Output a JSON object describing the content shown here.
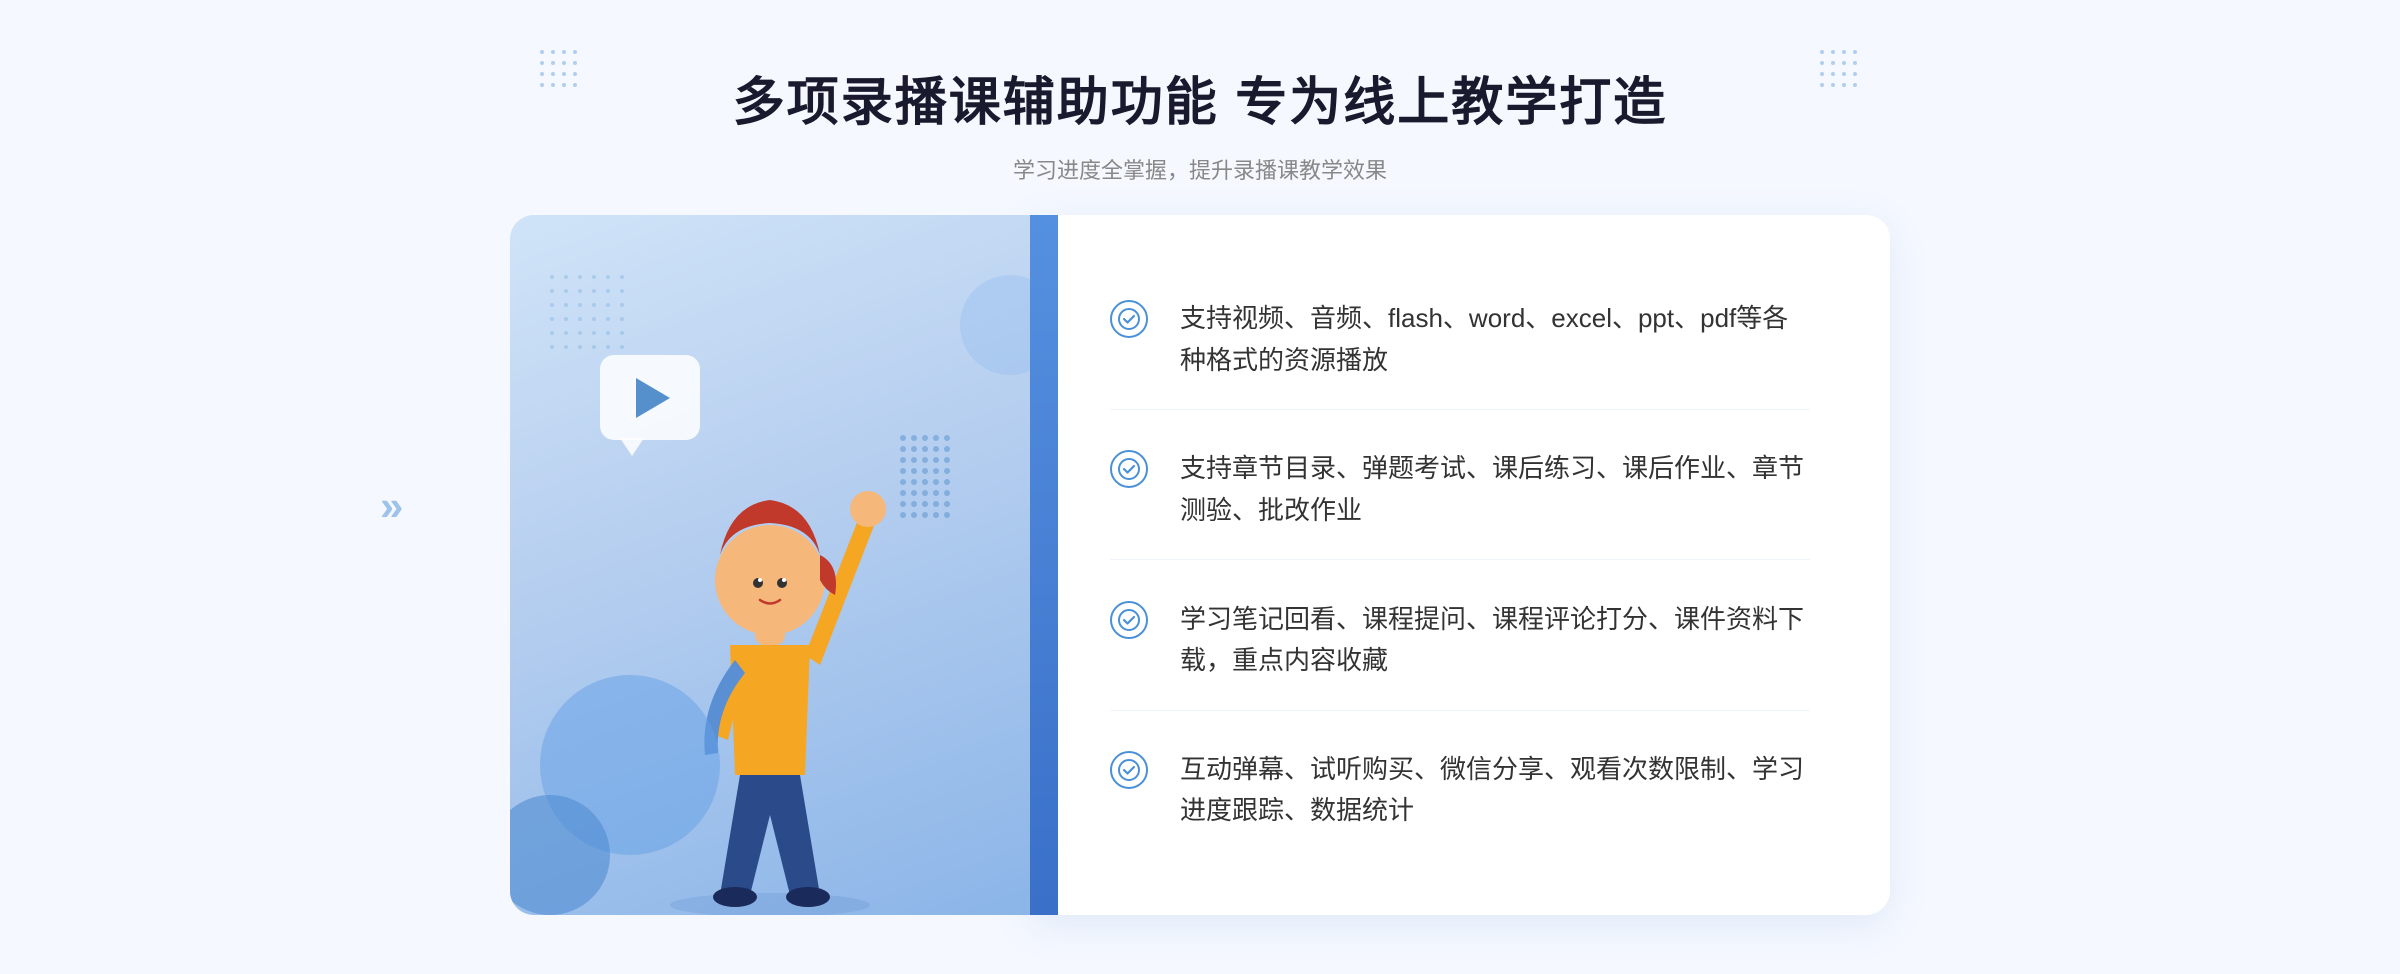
{
  "header": {
    "title": "多项录播课辅助功能 专为线上教学打造",
    "subtitle": "学习进度全掌握，提升录播课教学效果"
  },
  "features": [
    {
      "id": "feature-1",
      "text": "支持视频、音频、flash、word、excel、ppt、pdf等各种格式的资源播放"
    },
    {
      "id": "feature-2",
      "text": "支持章节目录、弹题考试、课后练习、课后作业、章节测验、批改作业"
    },
    {
      "id": "feature-3",
      "text": "学习笔记回看、课程提问、课程评论打分、课件资料下载，重点内容收藏"
    },
    {
      "id": "feature-4",
      "text": "互动弹幕、试听购买、微信分享、观看次数限制、学习进度跟踪、数据统计"
    }
  ],
  "decoration": {
    "chevron_left": "»",
    "check_symbol": "✓"
  }
}
